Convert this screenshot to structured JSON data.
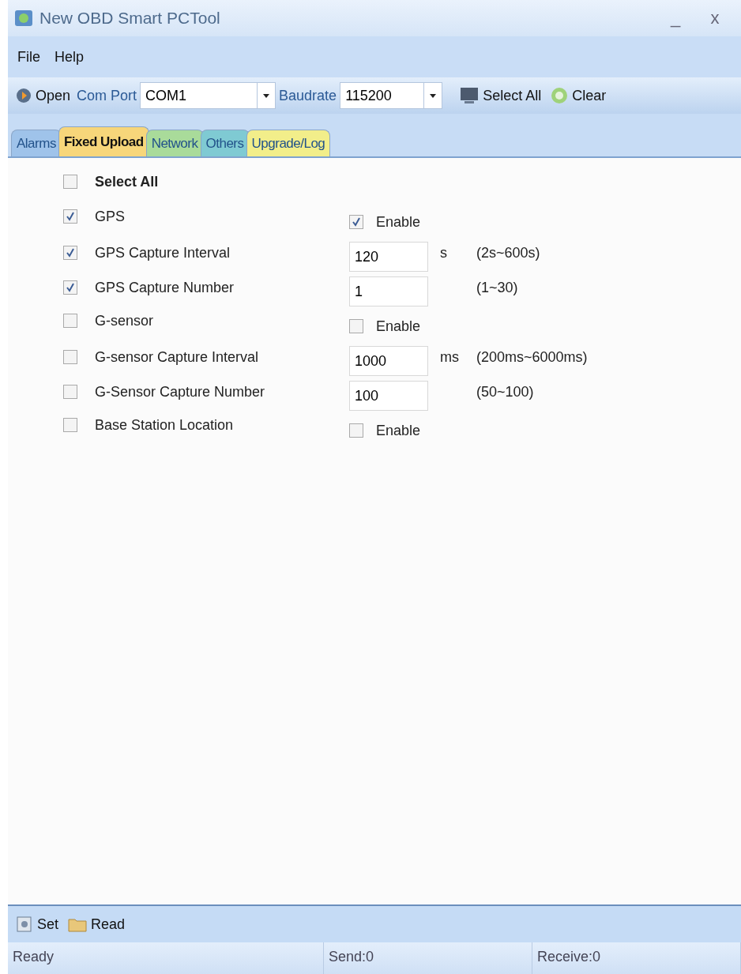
{
  "window": {
    "title": "New OBD Smart PCTool",
    "controls": [
      "_",
      "x"
    ]
  },
  "menu": [
    "File",
    "Help"
  ],
  "toolbar": {
    "open": "Open",
    "com_port_label": "Com Port",
    "com_port": "COM1",
    "baudrate_label": "Baudrate",
    "baudrate": "115200",
    "select_all": "Select All",
    "clear": "Clear"
  },
  "tabs": [
    {
      "label": "Alarms",
      "selected": false,
      "color": "#9fc3ea"
    },
    {
      "label": "Fixed Upload",
      "selected": true,
      "color": "#f7d67a"
    },
    {
      "label": "Network",
      "selected": false,
      "color": "#a9db9a"
    },
    {
      "label": "Others",
      "selected": false,
      "color": "#7fcad3"
    },
    {
      "label": "Upgrade/Log",
      "selected": false,
      "color": "#f2ee8a"
    }
  ],
  "rows": [
    {
      "kind": "header",
      "label": "Select All",
      "checked": false
    },
    {
      "kind": "enable",
      "label": "GPS",
      "checked": true,
      "enable": {
        "label": "Enable",
        "checked": true
      }
    },
    {
      "kind": "field",
      "label": "GPS Capture Interval",
      "checked": true,
      "value": "120",
      "unit": "s",
      "range": "(2s~600s)"
    },
    {
      "kind": "field",
      "label": "GPS Capture Number",
      "checked": true,
      "value": "1",
      "range": "(1~30)"
    },
    {
      "kind": "enable",
      "label": "G-sensor",
      "checked": false,
      "enable": {
        "label": "Enable",
        "checked": false
      }
    },
    {
      "kind": "field",
      "label": "G-sensor Capture Interval",
      "checked": false,
      "value": "1000",
      "unit": "ms",
      "range": "(200ms~6000ms)"
    },
    {
      "kind": "field",
      "label": "G-Sensor Capture Number",
      "checked": false,
      "value": "100",
      "range": "(50~100)"
    },
    {
      "kind": "enable",
      "label": "Base Station Location",
      "checked": false,
      "enable": {
        "label": "Enable",
        "checked": false
      }
    }
  ],
  "actions": [
    "Set",
    "Read"
  ],
  "status_bar": [
    "Ready",
    "Send:0",
    "Receive:0"
  ]
}
